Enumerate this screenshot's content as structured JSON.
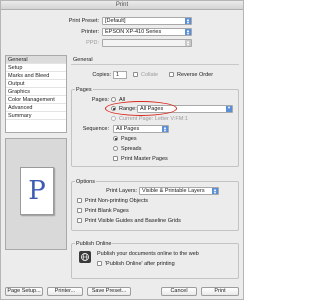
{
  "window": {
    "title": "Print"
  },
  "header": {
    "preset_label": "Print Preset:",
    "preset_value": "[Default]",
    "printer_label": "Printer:",
    "printer_value": "EPSON XP-410 Series",
    "ppd_label": "PPD:",
    "ppd_value": ""
  },
  "sidebar": {
    "items": [
      {
        "label": "General"
      },
      {
        "label": "Setup"
      },
      {
        "label": "Marks and Bleed"
      },
      {
        "label": "Output"
      },
      {
        "label": "Graphics"
      },
      {
        "label": "Color Management"
      },
      {
        "label": "Advanced"
      },
      {
        "label": "Summary"
      }
    ],
    "active_index": 0
  },
  "preview": {
    "glyph": "P"
  },
  "general": {
    "section_title": "General",
    "copies_label": "Copies:",
    "copies_value": "1",
    "collate_label": "Collate",
    "reverse_order_label": "Reverse Order"
  },
  "pages": {
    "group_label": "Pages",
    "pages_label": "Pages:",
    "all_label": "All",
    "range_label": "Range:",
    "range_value": "All Pages",
    "current_page_label": "Current Page: Letter V:FM:1",
    "sequence_label": "Sequence:",
    "sequence_value": "All Pages",
    "pages_radio_label": "Pages",
    "spreads_radio_label": "Spreads",
    "master_pages_label": "Print Master Pages",
    "selected_option": "Range"
  },
  "options": {
    "group_label": "Options",
    "print_layers_label": "Print Layers:",
    "print_layers_value": "Visible & Printable Layers",
    "non_printing_label": "Print Non-printing Objects",
    "blank_pages_label": "Print Blank Pages",
    "visible_guides_label": "Print Visible Guides and Baseline Grids"
  },
  "publish": {
    "group_label": "Publish Online",
    "message": "Publish your documents online to the web",
    "after_printing_label": "'Publish Online' after printing"
  },
  "footer": {
    "page_setup_label": "Page Setup...",
    "printer_label": "Printer...",
    "save_preset_label": "Save Preset...",
    "cancel_label": "Cancel",
    "print_label": "Print"
  },
  "colors": {
    "accent": "#5a8fd8",
    "highlight_ring": "#d9261c"
  }
}
